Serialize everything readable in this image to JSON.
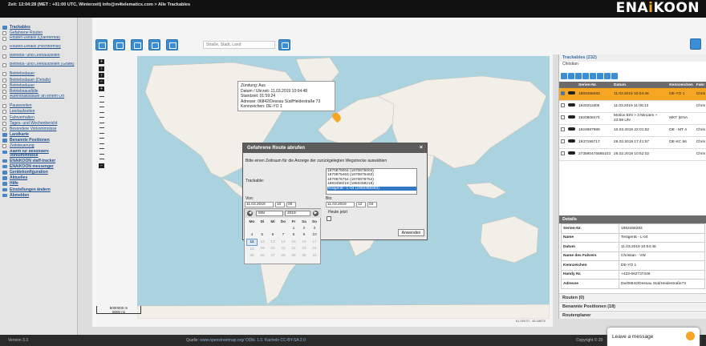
{
  "header": {
    "info": "Zeit: 12:04:28 (MET : +01:00 UTC, Winterzeit) info@m4telematics.com > Alle Trackables",
    "logo_text": "ENA",
    "logo_i": "i",
    "logo_rest": "KOON"
  },
  "sidebar": {
    "items": [
      {
        "label": "Trackables",
        "head": true
      },
      {
        "label": "Gefahrene Routen"
      },
      {
        "label": "Routen-Details (Querformat)",
        "two": true
      },
      {
        "label": "Routen-Details (Hochformat)",
        "two": true
      },
      {
        "label": "Betriebs- und Leerlaufzeiten",
        "two": true
      },
      {
        "label": "Betriebs- und Leerlaufzeiten (Grafik)",
        "two": true
      },
      {
        "label": "Betriebsdauer"
      },
      {
        "label": "Betriebsdauer (Details)"
      },
      {
        "label": "Betriebsdauer"
      },
      {
        "label": "Betriebsausfälle"
      },
      {
        "label": "Aufenthaltsdauer an einem Ort",
        "two": true
      },
      {
        "label": "Pausezeiten"
      },
      {
        "label": "Leerlaufzeiten"
      },
      {
        "label": "Fahrverhalten"
      },
      {
        "label": "Tages- und Wochenbericht"
      },
      {
        "label": "Besondere Vorkommnisse"
      },
      {
        "label": "Landkarte",
        "head": true
      },
      {
        "label": "Benannte Positionen",
        "head": true
      },
      {
        "label": "Zeitsteuerung"
      },
      {
        "label": "Alarm für besondere Vorkommnisse",
        "head": true,
        "two": true
      },
      {
        "label": "ENAiKOON staff-tracker",
        "head": true
      },
      {
        "label": "ENAiKOON messenger",
        "head": true
      },
      {
        "label": "Gerätekonfiguration",
        "head": true
      },
      {
        "label": "Aktuelles",
        "head": true
      },
      {
        "label": "Hilfe",
        "head": true
      },
      {
        "label": "Einstellungen ändern",
        "head": true
      },
      {
        "label": "Abmelden",
        "head": true
      }
    ]
  },
  "toolbar": {
    "search_placeholder": "Straße, Stadt, Land"
  },
  "map": {
    "popup_lines": [
      "Zündung: Aus",
      "Datum / Uhrzeit: 11.03.2019 10:04:48",
      "Standzeit: 01:59:24",
      "Adresse: 06842/Dessau Süd/Heidestraße 73",
      "Kennzeichen: DE-YO 1"
    ],
    "scale_top": "5000000 m",
    "scale_bottom": "5000 mi",
    "coords": "61.00070 , 48.18875"
  },
  "dialog": {
    "title": "Gefahrene Route abrufen",
    "close": "×",
    "instruction": "Bitte einen Zeitraum für die Anzeige der zurückgelegten Wegstrecke auswählen",
    "trackable_label": "Trackable:",
    "options": [
      {
        "label": "1870875004 (1870875004)"
      },
      {
        "label": "1870875463 (1870875463)"
      },
      {
        "label": "1870876754 (1870876754)"
      },
      {
        "label": "1883458218 (1883458218)"
      },
      {
        "label": "Testgerät - L-04 (1883458283)",
        "selected": true
      }
    ],
    "von_label": "Von:",
    "von_date": "11.03.2019",
    "von_hour": "10",
    "von_min": "00",
    "bis_label": "Bis:",
    "bis_date": "11.03.2019",
    "bis_hour": "12",
    "bis_min": "04",
    "heute_label": "Heute jetzt",
    "button": "Anwenden"
  },
  "calendar": {
    "prev": "◀",
    "next": "▶",
    "month": "Mär",
    "year": "2019",
    "weekdays": [
      "Mo",
      "Di",
      "Mi",
      "Do",
      "Fr",
      "Sa",
      "So"
    ],
    "rows": [
      [
        "",
        "",
        "",
        "",
        "1",
        "2",
        "3"
      ],
      [
        "4",
        "5",
        "6",
        "7",
        "8",
        "9",
        "10"
      ],
      [
        "11",
        "12",
        "13",
        "14",
        "15",
        "16",
        "17"
      ],
      [
        "18",
        "19",
        "20",
        "21",
        "22",
        "23",
        "24"
      ],
      [
        "25",
        "26",
        "27",
        "28",
        "29",
        "30",
        "31"
      ]
    ],
    "today": "11"
  },
  "trackables": {
    "title": "Trackables (232)",
    "subtitle": "Christian",
    "columns": [
      "",
      "",
      "Serien-Nr.",
      "Datum",
      "Kennzeichen",
      "Fahr"
    ],
    "rows": [
      {
        "serial": "1883458283",
        "date": "11.03.2019 10:04:48",
        "plate": "DE-YO 1",
        "driver": "Chris",
        "highlight": true,
        "checked": true
      },
      {
        "serial": "1920211805",
        "date": "11.03.2019 11:06:12",
        "plate": "",
        "driver": "Chris"
      },
      {
        "serial": "1920908474",
        "date": "Motion EIN > 3 Minuten + 23:59 Uhr",
        "plate": "MKT (ENA",
        "driver": ""
      },
      {
        "serial": "1924987989",
        "date": "10.03.2019 22:01:52",
        "plate": "DE - MT 4",
        "driver": "Chris"
      },
      {
        "serial": "1937195717",
        "date": "26.02.2019 17:41:57",
        "plate": "DE-KC 66",
        "driver": "Chris"
      },
      {
        "serial": "273590475585103",
        "date": "28.02.2019 10:52:02",
        "plate": "",
        "driver": "Chris"
      }
    ]
  },
  "details": {
    "title": "Details",
    "rows": [
      {
        "key": "Serien-Nr.",
        "value": "1883458283"
      },
      {
        "key": "Name",
        "value": "Testgerät - L-04"
      },
      {
        "key": "Datum",
        "value": "11.03.2019 10:04:48"
      },
      {
        "key": "Name des Fahrers",
        "value": "Christian - VW"
      },
      {
        "key": "Kennzeichen",
        "value": "DE-YO 1"
      },
      {
        "key": "Handy Nr.",
        "value": "+423-662737449"
      },
      {
        "key": "Adresse",
        "value": "De/06842/Dessau Süd/Heidestraße73"
      }
    ]
  },
  "accordions": [
    "Routen (0)",
    "Benannte Positionen (18)",
    "Routenplaner"
  ],
  "footer": {
    "version": "Version 3.3",
    "source_label": "Quelle:",
    "source_link": "www.openstreetmap.org/ ODbL 1.0. Kacheln CC-BY-SA 2.0",
    "copyright": "Copyright © 20"
  },
  "chat": {
    "label": "Leave a message"
  }
}
